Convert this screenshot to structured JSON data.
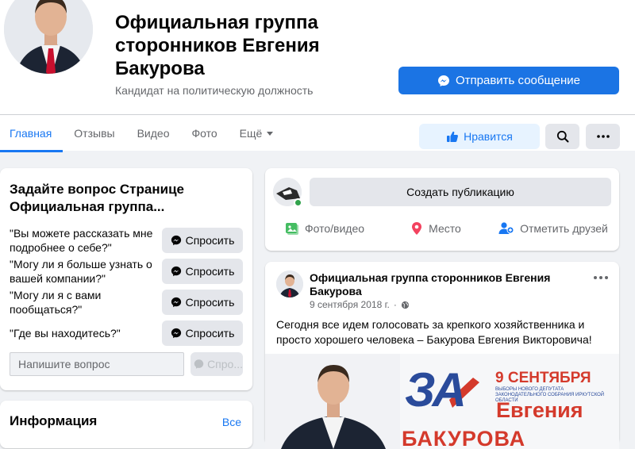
{
  "colors": {
    "accent": "#1877f2",
    "primary_button": "#1b74e4",
    "background": "#f0f2f5"
  },
  "header": {
    "title": "Официальная группа сторонников Евгения Бакурова",
    "category": "Кандидат на политическую должность",
    "message_button": "Отправить сообщение",
    "like_button": "Нравится",
    "icons": {
      "message": "messenger-icon",
      "like": "thumbs-up-icon",
      "search": "search-icon",
      "more": "more-dots-icon"
    }
  },
  "tabs": [
    {
      "label": "Главная",
      "active": true
    },
    {
      "label": "Отзывы"
    },
    {
      "label": "Видео"
    },
    {
      "label": "Фото"
    },
    {
      "label": "Ещё"
    }
  ],
  "ask": {
    "title": "Задайте вопрос Странице Официальная группа...",
    "questions": [
      "\"Вы можете рассказать мне подробнее о себе?\"",
      "\"Могу ли я больше узнать о вашей компании?\"",
      "\"Могу ли я с вами пообщаться?\"",
      "\"Где вы находитесь?\""
    ],
    "button_label": "Спросить",
    "input_placeholder": "Напишите вопрос",
    "disabled_button_label": "Спро..."
  },
  "info": {
    "title": "Информация",
    "see_all": "Все"
  },
  "composer": {
    "prompt": "Создать публикацию",
    "actions": [
      {
        "label": "Фото/видео",
        "icon": "photo-icon",
        "color": "#45bd62"
      },
      {
        "label": "Место",
        "icon": "location-pin-icon",
        "color": "#f3425f"
      },
      {
        "label": "Отметить друзей",
        "icon": "tag-friends-icon",
        "color": "#1877f2"
      }
    ]
  },
  "post": {
    "author": "Официальная группа сторонников Евгения Бакурова",
    "date": "9 сентября 2018 г.",
    "separator": "·",
    "privacy_icon": "globe-icon",
    "text": "Сегодня все идем голосовать за крепкого хозяйственника и просто хорошего человека – Бакурова Евгения Викторовича!",
    "poster": {
      "za": "ЗА",
      "date": "9 СЕНТЯБРЯ",
      "subtitle": "ВЫБОРЫ НОВОГО ДЕПУТАТА ЗАКОНОДАТЕЛЬНОГО СОБРАНИЯ ИРКУТСКОЙ ОБЛАСТИ",
      "name": "Евгения",
      "surname": "БАКУРОВА"
    }
  }
}
